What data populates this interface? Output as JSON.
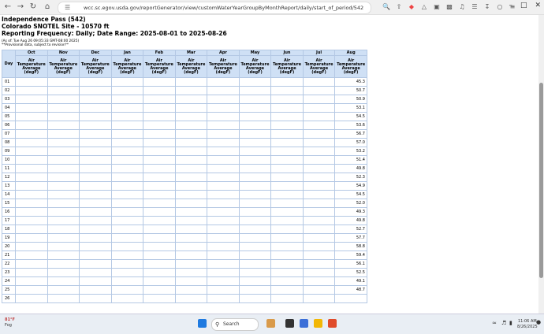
{
  "browser": {
    "url": "wcc.sc.egov.usda.gov/reportGenerator/view/customWaterYearGroupByMonthReport/daily/start_of_period/542:CO:SNTL%2..."
  },
  "report": {
    "title_line1": "Independence Pass (542)",
    "title_line2": "Colorado SNOTEL Site - 10570 ft",
    "title_line3": "Reporting Frequency: Daily; Date Range: 2025-08-01 to 2025-08-26",
    "asof": "(As of: Tue Aug 26 09:05:33 GMT-08:00 2025)",
    "provisional": "**Provisional data, subject to revision**"
  },
  "table": {
    "day_header": "Day",
    "months": [
      "Oct",
      "Nov",
      "Dec",
      "Jan",
      "Feb",
      "Mar",
      "Apr",
      "May",
      "Jun",
      "Jul",
      "Aug"
    ],
    "sub_header": [
      "Air",
      "Temperature",
      "Average",
      "(degF)"
    ],
    "rows": [
      {
        "day": "01",
        "aug": "45.3"
      },
      {
        "day": "02",
        "aug": "50.7"
      },
      {
        "day": "03",
        "aug": "50.9"
      },
      {
        "day": "04",
        "aug": "53.1"
      },
      {
        "day": "05",
        "aug": "54.5"
      },
      {
        "day": "06",
        "aug": "53.6"
      },
      {
        "day": "07",
        "aug": "56.7"
      },
      {
        "day": "08",
        "aug": "57.0"
      },
      {
        "day": "09",
        "aug": "53.2"
      },
      {
        "day": "10",
        "aug": "51.4"
      },
      {
        "day": "11",
        "aug": "49.8"
      },
      {
        "day": "12",
        "aug": "52.3"
      },
      {
        "day": "13",
        "aug": "54.9"
      },
      {
        "day": "14",
        "aug": "54.5"
      },
      {
        "day": "15",
        "aug": "52.0"
      },
      {
        "day": "16",
        "aug": "49.3"
      },
      {
        "day": "17",
        "aug": "49.8"
      },
      {
        "day": "18",
        "aug": "52.7"
      },
      {
        "day": "19",
        "aug": "57.7"
      },
      {
        "day": "20",
        "aug": "58.8"
      },
      {
        "day": "21",
        "aug": "59.4"
      },
      {
        "day": "22",
        "aug": "56.1"
      },
      {
        "day": "23",
        "aug": "52.5"
      },
      {
        "day": "24",
        "aug": "49.1"
      },
      {
        "day": "25",
        "aug": "48.7"
      },
      {
        "day": "26",
        "aug": ""
      }
    ]
  },
  "taskbar": {
    "weather_temp": "81°F",
    "weather_cond": "Fog",
    "search_label": "Search",
    "time": "11:06 AM",
    "date": "8/26/2025"
  }
}
